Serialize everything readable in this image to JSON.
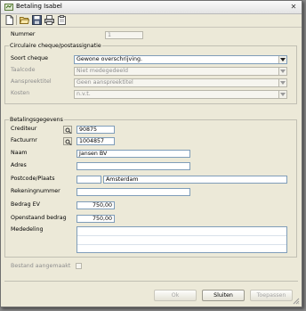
{
  "window": {
    "title": "Betaling Isabel"
  },
  "toolbar": {
    "icons": [
      "new-document-icon",
      "open-folder-icon",
      "save-icon",
      "print-icon",
      "clipboard-icon"
    ]
  },
  "form": {
    "number_label": "Nummer",
    "number_value": "1"
  },
  "circular_group": {
    "title": "Circulaire cheque/postassignatie",
    "check_type_label": "Soort cheque",
    "check_type_value": "Gewone overschrijving.",
    "language_label": "Taalcode",
    "language_value": "Niet medegedeeld",
    "salutation_label": "Aanspreektitel",
    "salutation_value": "Geen aanspreektitel",
    "costs_label": "Kosten",
    "costs_value": "n.v.t."
  },
  "payment_group": {
    "title": "Betalingsgegevens",
    "creditor_label": "Crediteur",
    "creditor_value": "90875",
    "invoice_label": "Factuurnr",
    "invoice_value": "1004857",
    "name_label": "Naam",
    "name_value": "Jansen BV",
    "address_label": "Adres",
    "address_value": "",
    "postcode_label": "Postcode/Plaats",
    "postcode_value": "",
    "city_value": "Amsterdam",
    "account_label": "Rekeningnummer",
    "account_value": "",
    "amount_label": "Bedrag EV",
    "amount_value": "750,00",
    "outstanding_label": "Openstaand bedrag",
    "outstanding_value": "750,00",
    "message_label": "Mededeling"
  },
  "footer": {
    "file_created_label": "Bestand aangemaakt",
    "file_created_checked": false,
    "ok_label": "Ok",
    "close_label": "Sluiten",
    "apply_label": "Toepassen"
  }
}
